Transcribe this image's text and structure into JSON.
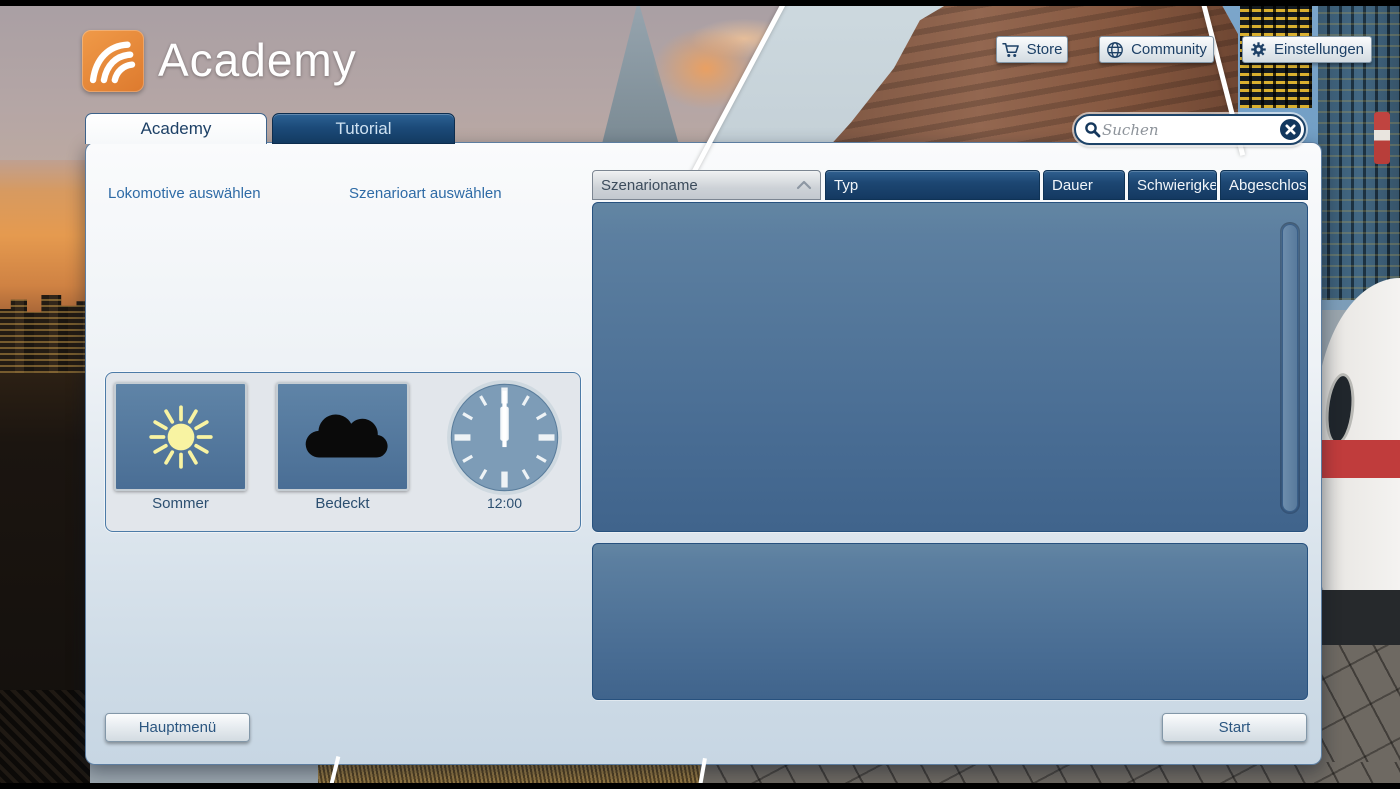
{
  "header": {
    "logo_text": "Academy",
    "store_label": "Store",
    "community_label": "Community",
    "settings_label": "Einstellungen"
  },
  "tabs": {
    "academy": "Academy",
    "tutorial": "Tutorial"
  },
  "search": {
    "placeholder": "Suchen",
    "value": ""
  },
  "selectors": {
    "locomotive": "Lokomotive auswählen",
    "scenario_type": "Szenarioart auswählen"
  },
  "weather": {
    "season": "Sommer",
    "condition": "Bedeckt",
    "time": "12:00"
  },
  "table": {
    "columns": [
      "Szenarioname",
      "Typ",
      "Dauer",
      "Schwierigke",
      "Abgeschlos"
    ],
    "sorted_column": "Szenarioname",
    "sort_direction": "asc",
    "rows": []
  },
  "footer": {
    "main_menu": "Hauptmenü",
    "start": "Start"
  },
  "colors": {
    "logo_orange": "#e8863c",
    "header_navy": "#1d4773",
    "panel_steel_blue": "#4f7298",
    "panel_light": "#dce6ee",
    "text_blue": "#1d4066",
    "sun_yellow": "#f8f3a2",
    "stripe_red": "#c03c3c"
  }
}
